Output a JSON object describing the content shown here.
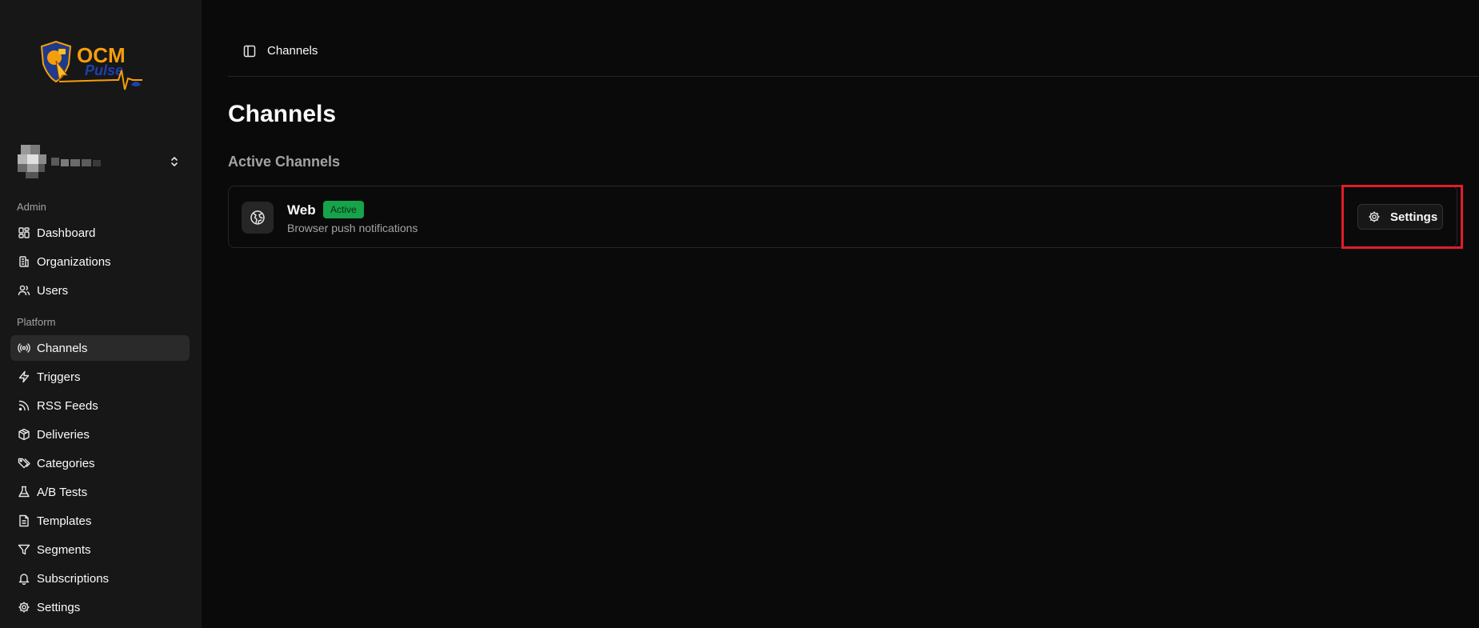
{
  "logo": {
    "line1": "OCM",
    "line2": "Pulse"
  },
  "sidebar": {
    "groups": [
      {
        "label": "Admin"
      },
      {
        "label": "Platform"
      }
    ],
    "items": [
      {
        "label": "Dashboard",
        "icon": "dashboard-icon"
      },
      {
        "label": "Organizations",
        "icon": "building-icon"
      },
      {
        "label": "Users",
        "icon": "users-icon"
      },
      {
        "label": "Channels",
        "icon": "radio-icon",
        "active": true
      },
      {
        "label": "Triggers",
        "icon": "zap-icon"
      },
      {
        "label": "RSS Feeds",
        "icon": "rss-icon"
      },
      {
        "label": "Deliveries",
        "icon": "package-icon"
      },
      {
        "label": "Categories",
        "icon": "tags-icon"
      },
      {
        "label": "A/B Tests",
        "icon": "flask-icon"
      },
      {
        "label": "Templates",
        "icon": "file-text-icon"
      },
      {
        "label": "Segments",
        "icon": "filter-icon"
      },
      {
        "label": "Subscriptions",
        "icon": "bell-icon"
      },
      {
        "label": "Settings",
        "icon": "gear-icon"
      }
    ]
  },
  "header": {
    "breadcrumb": "Channels"
  },
  "main": {
    "title": "Channels",
    "section_title": "Active Channels",
    "channels": [
      {
        "name": "Web",
        "status": "Active",
        "description": "Browser push notifications",
        "action_label": "Settings",
        "icon": "globe-icon"
      }
    ]
  },
  "colors": {
    "background": "#0a0a0a",
    "sidebar": "#171717",
    "active_badge": "#16a34a",
    "highlight": "#e11d2a",
    "logo_orange": "#f59e0b",
    "logo_blue": "#1e40af"
  }
}
